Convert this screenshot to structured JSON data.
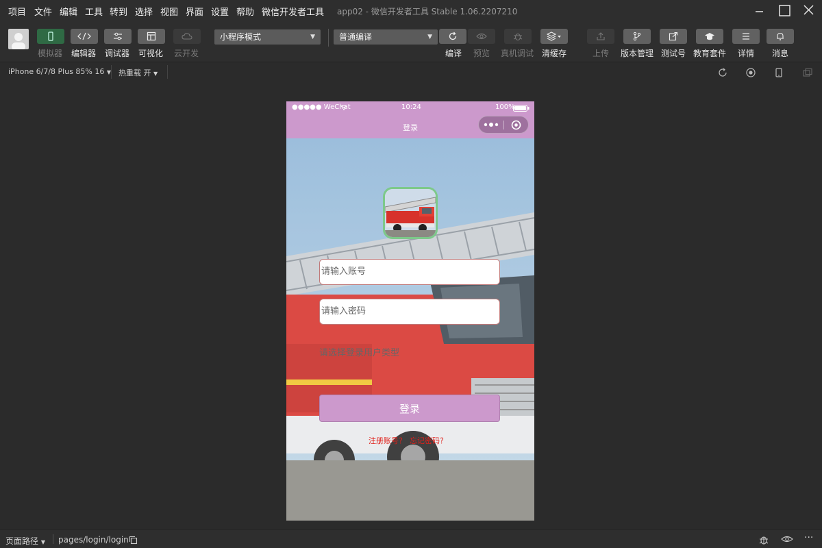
{
  "menu": {
    "items": [
      "项目",
      "文件",
      "编辑",
      "工具",
      "转到",
      "选择",
      "视图",
      "界面",
      "设置",
      "帮助",
      "微信开发者工具"
    ],
    "window_title": "app02 - 微信开发者工具 Stable 1.06.2207210"
  },
  "toolbar": {
    "simulator": "模拟器",
    "editor": "编辑器",
    "debugger": "调试器",
    "visual": "可视化",
    "cloud": "云开发",
    "mode_select": "小程序模式",
    "compile_select": "普通编译",
    "compile": "编译",
    "preview": "预览",
    "remote_debug": "真机调试",
    "clear_cache": "清缓存",
    "upload": "上传",
    "version": "版本管理",
    "test_id": "测试号",
    "edu": "教育套件",
    "details": "详情",
    "messages": "消息"
  },
  "subbar": {
    "device": "iPhone 6/7/8 Plus 85% 16",
    "hot_reload": "热重载 开"
  },
  "phone": {
    "signal": "●●●●● WeChat",
    "time": "10:24",
    "battery": "100%",
    "nav_title": "登录",
    "account_placeholder": "请输入账号",
    "password_placeholder": "请输入密码",
    "role_prompt": "请选择登录用户类型",
    "login_button": "登录",
    "register_link": "注册账号？",
    "forgot_link": "忘记密码？"
  },
  "statusbar": {
    "path_label": "页面路径",
    "path": "pages/login/login"
  }
}
